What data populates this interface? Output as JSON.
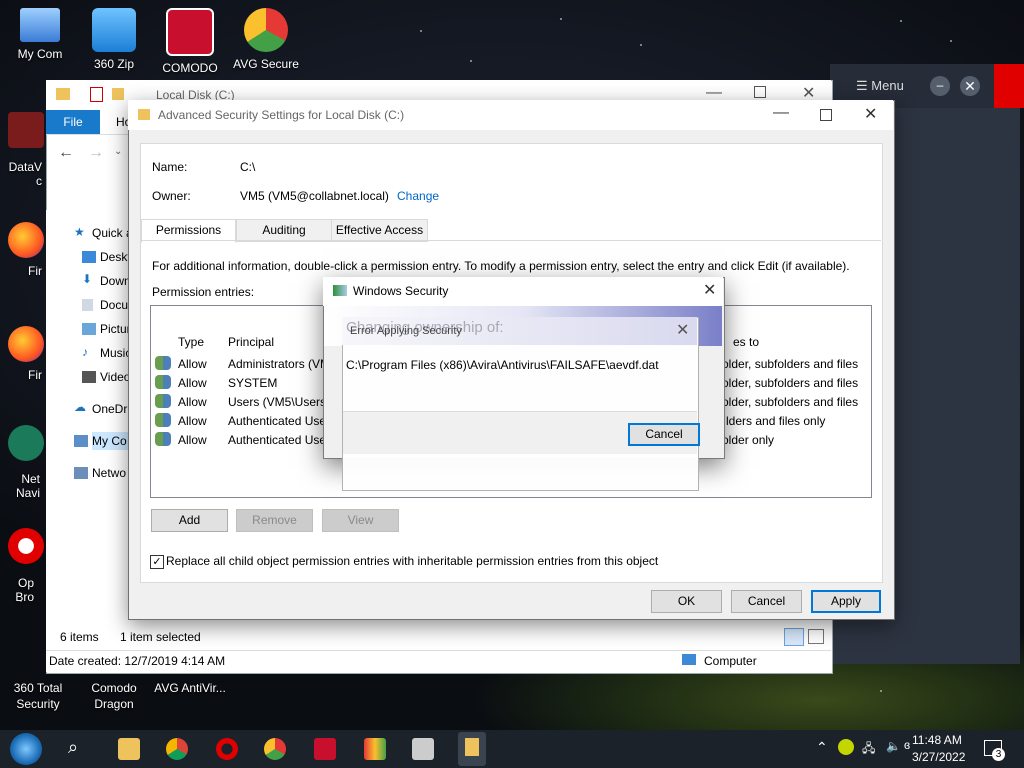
{
  "desktop": {
    "icons_top": [
      {
        "label": "My Com"
      },
      {
        "label": "360 Zip"
      },
      {
        "label": "COMODO"
      },
      {
        "label": "AVG Secure"
      }
    ],
    "icons_left": [
      {
        "label": "DataV c"
      },
      {
        "label": "Fir"
      },
      {
        "label": "Fir"
      },
      {
        "label": "Net Navi"
      },
      {
        "label": "Op Bro"
      }
    ],
    "icons_bottom": [
      {
        "label": "360 Total Security"
      },
      {
        "label": "Comodo Dragon"
      },
      {
        "label": "AVG AntiVir..."
      }
    ]
  },
  "avg_window": {
    "menu_label": "Menu"
  },
  "explorer": {
    "title": "Local Disk (C:)",
    "file_tab": "File",
    "home_tab": "Ho",
    "nav": [
      {
        "label": "Quick a"
      },
      {
        "label": "Deskt"
      },
      {
        "label": "Down"
      },
      {
        "label": "Docu"
      },
      {
        "label": "Pictur"
      },
      {
        "label": "Music"
      },
      {
        "label": "Video"
      },
      {
        "label": "OneDri"
      },
      {
        "label": "My Co"
      },
      {
        "label": "Netwo"
      }
    ],
    "status_items": "6 items",
    "status_selected": "1 item selected",
    "date_created": "Date created: 12/7/2019 4:14 AM",
    "computer_label": "Computer"
  },
  "advanced": {
    "title": "Advanced Security Settings for Local Disk (C:)",
    "name_label": "Name:",
    "name_value": "C:\\",
    "owner_label": "Owner:",
    "owner_value": "VM5 (VM5@collabnet.local)",
    "change_link": "Change",
    "tabs": [
      "Permissions",
      "Auditing",
      "Effective Access"
    ],
    "info_text": "For additional information, double-click a permission entry. To modify a permission entry, select the entry and click Edit (if available).",
    "entries_label": "Permission entries:",
    "col_type": "Type",
    "col_principal": "Principal",
    "col_applies": "es to",
    "rows": [
      {
        "type": "Allow",
        "principal": "Administrators (VM",
        "applies": "older, subfolders and files"
      },
      {
        "type": "Allow",
        "principal": "SYSTEM",
        "applies": "older, subfolders and files"
      },
      {
        "type": "Allow",
        "principal": "Users (VM5\\Users)",
        "applies": "older, subfolders and files"
      },
      {
        "type": "Allow",
        "principal": "Authenticated Use",
        "applies": "lders and files only"
      },
      {
        "type": "Allow",
        "principal": "Authenticated Use",
        "applies": "older only"
      }
    ],
    "btn_add": "Add",
    "btn_remove": "Remove",
    "btn_view": "View",
    "replace_checkbox": "Replace all child object permission entries with inheritable permission entries from this object",
    "btn_ok": "OK",
    "btn_cancel": "Cancel",
    "btn_apply": "Apply"
  },
  "windows_security": {
    "title": "Windows Security",
    "header_overlay": "Changing ownership of:",
    "error_title": "Error Applying Security",
    "path": "C:\\Program Files (x86)\\Avira\\Antivirus\\FAILSAFE\\aevdf.dat",
    "btn_cancel": "Cancel"
  },
  "taskbar": {
    "time": "11:48 AM",
    "date": "3/27/2022",
    "notification_count": "3"
  }
}
